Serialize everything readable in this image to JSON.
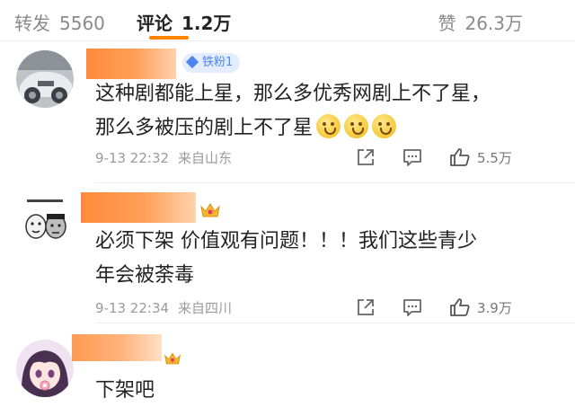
{
  "tabs": {
    "repost_label": "转发",
    "repost_count": "5560",
    "comment_label": "评论",
    "comment_count": "1.2万",
    "like_label": "赞",
    "like_count": "26.3万"
  },
  "comments": [
    {
      "badge": "铁粉1",
      "text_line1": "这种剧都能上星，那么多优秀网剧上不了星，",
      "text_line2": "那么多被压的剧上不了星",
      "emojis": [
        "grin-emoji",
        "grin-emoji",
        "grin-emoji"
      ],
      "time": "9-13 22:32",
      "location": "来自山东",
      "likes": "5.5万"
    },
    {
      "text_line1": "必须下架 价值观有问题！！！我们这些青少",
      "text_line2": "年会被荼毒",
      "time": "9-13 22:34",
      "location": "来自四川",
      "likes": "3.9万"
    },
    {
      "text_line1": "下架吧"
    }
  ],
  "colors": {
    "accent": "#ff8200",
    "name_mask": "#ff8a3d",
    "badge_bg": "#e3edff",
    "badge_text": "#4d86f0",
    "meta_text": "#9a9a9a"
  }
}
